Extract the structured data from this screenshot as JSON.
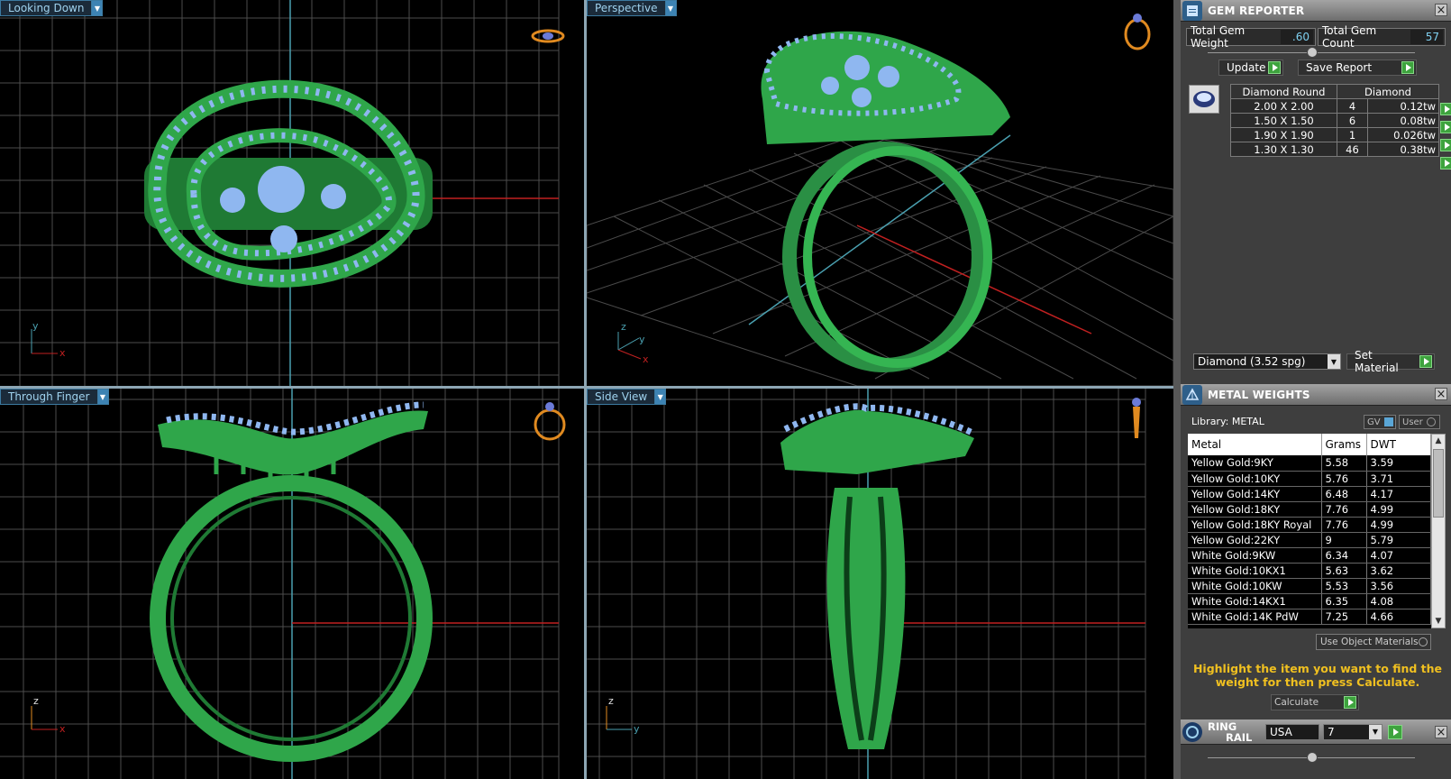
{
  "viewports": {
    "top_left": {
      "label": "Looking Down"
    },
    "top_right": {
      "label": "Perspective"
    },
    "bottom_left": {
      "label": "Through Finger"
    },
    "bottom_right": {
      "label": "Side View"
    }
  },
  "axis_labels": {
    "tl": {
      "a": "y",
      "b": "x"
    },
    "tr": {
      "a": "z",
      "b": "y",
      "c": "x"
    },
    "bl": {
      "a": "z",
      "b": "x"
    },
    "br": {
      "a": "z",
      "b": "y"
    }
  },
  "gem_reporter": {
    "title": "GEM REPORTER",
    "total_weight_label": "Total Gem Weight",
    "total_weight_value": ".60",
    "total_count_label": "Total Gem Count",
    "total_count_value": "57",
    "update_label": "Update",
    "save_report_label": "Save Report",
    "table_headers": [
      "Diamond Round",
      "Diamond"
    ],
    "rows": [
      {
        "size": "2.00 X 2.00",
        "count": "4",
        "weight": "0.12tw"
      },
      {
        "size": "1.50 X 1.50",
        "count": "6",
        "weight": "0.08tw"
      },
      {
        "size": "1.90 X 1.90",
        "count": "1",
        "weight": "0.026tw"
      },
      {
        "size": "1.30 X 1.30",
        "count": "46",
        "weight": "0.38tw"
      }
    ],
    "material_select": "Diamond   (3.52 spg)",
    "set_material_label": "Set Material"
  },
  "metal_weights": {
    "title": "METAL WEIGHTS",
    "library_label": "Library: METAL",
    "gv_label": "GV",
    "user_label": "User",
    "columns": [
      "Metal",
      "Grams",
      "DWT"
    ],
    "rows": [
      {
        "metal": "Yellow Gold:9KY",
        "grams": "5.58",
        "dwt": "3.59"
      },
      {
        "metal": "Yellow Gold:10KY",
        "grams": "5.76",
        "dwt": "3.71"
      },
      {
        "metal": "Yellow Gold:14KY",
        "grams": "6.48",
        "dwt": "4.17"
      },
      {
        "metal": "Yellow Gold:18KY",
        "grams": "7.76",
        "dwt": "4.99"
      },
      {
        "metal": "Yellow Gold:18KY Royal",
        "grams": "7.76",
        "dwt": "4.99"
      },
      {
        "metal": "Yellow Gold:22KY",
        "grams": "9",
        "dwt": "5.79"
      },
      {
        "metal": "White Gold:9KW",
        "grams": "6.34",
        "dwt": "4.07"
      },
      {
        "metal": "White Gold:10KX1",
        "grams": "5.63",
        "dwt": "3.62"
      },
      {
        "metal": "White Gold:10KW",
        "grams": "5.53",
        "dwt": "3.56"
      },
      {
        "metal": "White Gold:14KX1",
        "grams": "6.35",
        "dwt": "4.08"
      },
      {
        "metal": "White Gold:14K PdW",
        "grams": "7.25",
        "dwt": "4.66"
      }
    ],
    "use_object_materials": "Use Object Materials",
    "hint": "Highlight the item you want to find the weight for then press Calculate.",
    "calculate_label": "Calculate"
  },
  "ring_rail": {
    "title_line1": "RING",
    "title_line2": "RAIL",
    "region_value": "USA",
    "size_value": "7"
  },
  "colors": {
    "metal_green": "#2fa64a",
    "gem_blue": "#8fb7f0",
    "grid": "#5a5a5a",
    "axis_red": "#c02020",
    "axis_cyan": "#4aa0b0",
    "accent_yellow": "#f0c020"
  }
}
